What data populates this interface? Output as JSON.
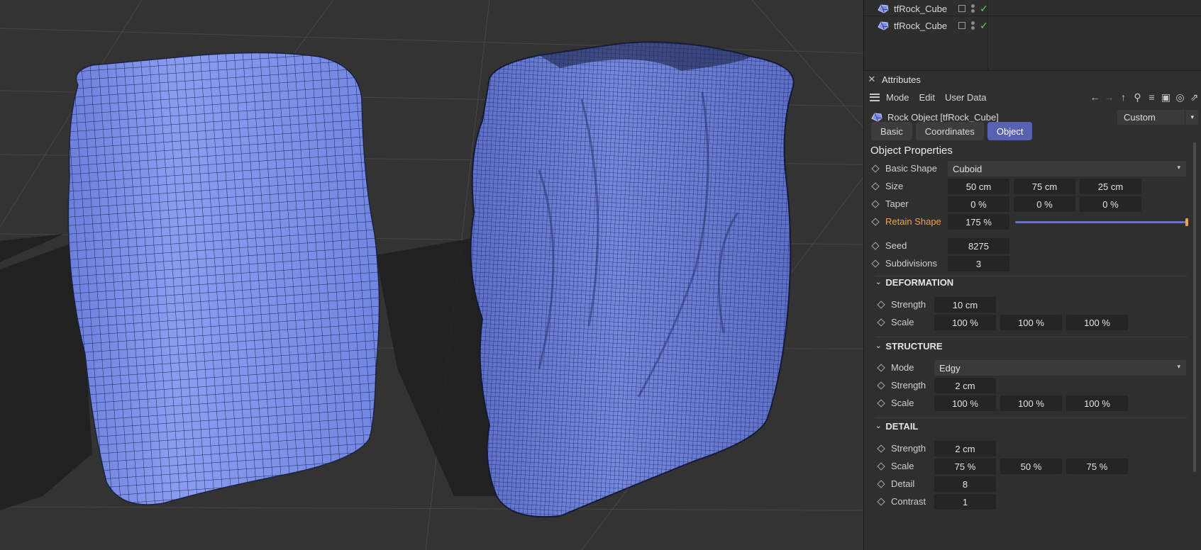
{
  "object_manager": {
    "rows": [
      {
        "name": "tfRock_Cube"
      },
      {
        "name": "tfRock_Cube"
      }
    ]
  },
  "attributes": {
    "title": "Attributes",
    "close_glyph": "✕",
    "menu": [
      "Mode",
      "Edit",
      "User Data"
    ],
    "toolbar_icons": [
      "back-arrow-icon",
      "forward-arrow-icon",
      "up-arrow-icon",
      "search-icon",
      "filter-icon",
      "lock-icon",
      "target-icon",
      "new-window-icon"
    ],
    "object_label": "Rock Object [tfRock_Cube]",
    "layout_dropdown": "Custom",
    "tabs": [
      {
        "label": "Basic",
        "active": false
      },
      {
        "label": "Coordinates",
        "active": false
      },
      {
        "label": "Object",
        "active": true
      }
    ],
    "section_title": "Object Properties",
    "basic_shape": {
      "label": "Basic Shape",
      "value": "Cuboid"
    },
    "size": {
      "label": "Size",
      "values": [
        "50 cm",
        "75 cm",
        "25 cm"
      ]
    },
    "taper": {
      "label": "Taper",
      "values": [
        "0 %",
        "0 %",
        "0 %"
      ]
    },
    "retain_shape": {
      "label": "Retain Shape",
      "value": "175 %",
      "slider_fraction": 1.0
    },
    "seed": {
      "label": "Seed",
      "value": "8275"
    },
    "subdivisions": {
      "label": "Subdivisions",
      "value": "3"
    },
    "deformation": {
      "title": "DEFORMATION",
      "strength": {
        "label": "Strength",
        "value": "10 cm"
      },
      "scale": {
        "label": "Scale",
        "values": [
          "100 %",
          "100 %",
          "100 %"
        ]
      }
    },
    "structure": {
      "title": "STRUCTURE",
      "mode": {
        "label": "Mode",
        "value": "Edgy"
      },
      "strength": {
        "label": "Strength",
        "value": "2 cm"
      },
      "scale": {
        "label": "Scale",
        "values": [
          "100 %",
          "100 %",
          "100 %"
        ]
      }
    },
    "detail": {
      "title": "DETAIL",
      "strength": {
        "label": "Strength",
        "value": "2 cm"
      },
      "scale": {
        "label": "Scale",
        "values": [
          "75 %",
          "50 %",
          "75 %"
        ]
      },
      "detail": {
        "label": "Detail",
        "value": "8"
      },
      "contrast": {
        "label": "Contrast",
        "value": "1"
      }
    }
  },
  "colors": {
    "accent": "#5862b3",
    "mesh_fill": "#7d8fe6",
    "retain_label": "#f0a24a",
    "check": "#57d46a"
  }
}
